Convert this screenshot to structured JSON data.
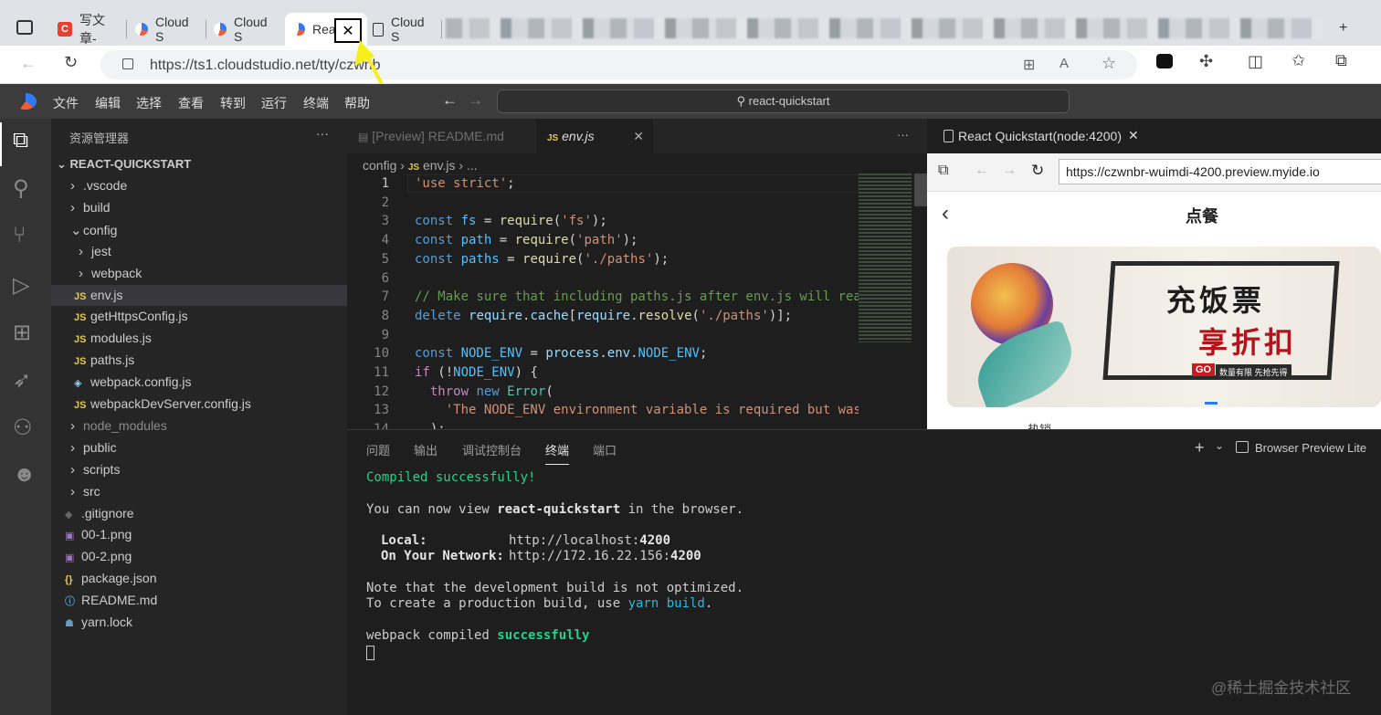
{
  "browser": {
    "tabs": [
      {
        "label": "写文章-",
        "icon": "juejin-icon",
        "color": "#e8402e"
      },
      {
        "label": "Cloud S",
        "icon": "cloudstudio-icon"
      },
      {
        "label": "Cloud S",
        "icon": "cloudstudio-icon"
      },
      {
        "label": "Rea",
        "icon": "cloudstudio-icon",
        "active": true
      },
      {
        "label": "Cloud S",
        "icon": "page-icon"
      }
    ],
    "close_glyph": "✕",
    "url": "https://ts1.cloudstudio.net/tty/czwnb"
  },
  "ide": {
    "menu": [
      "文件",
      "编辑",
      "选择",
      "查看",
      "转到",
      "运行",
      "终端",
      "帮助"
    ],
    "command_center": "react-quickstart",
    "sidebar_title": "资源管理器",
    "sidebar_more": "···",
    "root": "REACT-QUICKSTART",
    "tree": [
      {
        "label": ".vscode",
        "type": "folder"
      },
      {
        "label": "build",
        "type": "folder"
      },
      {
        "label": "config",
        "type": "folder-open"
      },
      {
        "label": "jest",
        "type": "folder",
        "indent": 1
      },
      {
        "label": "webpack",
        "type": "folder",
        "indent": 1
      },
      {
        "label": "env.js",
        "type": "js",
        "indent": 1,
        "selected": true
      },
      {
        "label": "getHttpsConfig.js",
        "type": "js",
        "indent": 1
      },
      {
        "label": "modules.js",
        "type": "js",
        "indent": 1
      },
      {
        "label": "paths.js",
        "type": "js",
        "indent": 1
      },
      {
        "label": "webpack.config.js",
        "type": "webpack",
        "indent": 1
      },
      {
        "label": "webpackDevServer.config.js",
        "type": "js",
        "indent": 1
      },
      {
        "label": "node_modules",
        "type": "folder"
      },
      {
        "label": "public",
        "type": "folder"
      },
      {
        "label": "scripts",
        "type": "folder"
      },
      {
        "label": "src",
        "type": "folder"
      },
      {
        "label": ".gitignore",
        "type": "git",
        "file": true
      },
      {
        "label": "00-1.png",
        "type": "image",
        "file": true
      },
      {
        "label": "00-2.png",
        "type": "image",
        "file": true
      },
      {
        "label": "package.json",
        "type": "json",
        "file": true
      },
      {
        "label": "README.md",
        "type": "info",
        "file": true
      },
      {
        "label": "yarn.lock",
        "type": "yarn",
        "file": true
      }
    ],
    "editor_tabs": [
      {
        "label": "[Preview] README.md"
      },
      {
        "label": "env.js",
        "active": true
      }
    ],
    "breadcrumb": [
      "config",
      "env.js",
      "..."
    ],
    "line_numbers": [
      "1",
      "2",
      "3",
      "4",
      "5",
      "6",
      "7",
      "8",
      "9",
      "10",
      "11",
      "12",
      "13",
      "14"
    ],
    "code": [
      [
        {
          "t": "'use strict'",
          "c": "str"
        },
        {
          "t": ";",
          "c": "pl"
        }
      ],
      [],
      [
        {
          "t": "const ",
          "c": "kw"
        },
        {
          "t": "fs",
          "c": "con"
        },
        {
          "t": " = ",
          "c": "pl"
        },
        {
          "t": "require",
          "c": "fn"
        },
        {
          "t": "(",
          "c": "pl"
        },
        {
          "t": "'fs'",
          "c": "str"
        },
        {
          "t": ");",
          "c": "pl"
        }
      ],
      [
        {
          "t": "const ",
          "c": "kw"
        },
        {
          "t": "path",
          "c": "con"
        },
        {
          "t": " = ",
          "c": "pl"
        },
        {
          "t": "require",
          "c": "fn"
        },
        {
          "t": "(",
          "c": "pl"
        },
        {
          "t": "'path'",
          "c": "str"
        },
        {
          "t": ");",
          "c": "pl"
        }
      ],
      [
        {
          "t": "const ",
          "c": "kw"
        },
        {
          "t": "paths",
          "c": "con"
        },
        {
          "t": " = ",
          "c": "pl"
        },
        {
          "t": "require",
          "c": "fn"
        },
        {
          "t": "(",
          "c": "pl"
        },
        {
          "t": "'./paths'",
          "c": "str"
        },
        {
          "t": ");",
          "c": "pl"
        }
      ],
      [],
      [
        {
          "t": "// Make sure that including paths.js after env.js will rea",
          "c": "cm"
        }
      ],
      [
        {
          "t": "delete ",
          "c": "kw"
        },
        {
          "t": "require",
          "c": "var"
        },
        {
          "t": ".",
          "c": "pl"
        },
        {
          "t": "cache",
          "c": "var"
        },
        {
          "t": "[",
          "c": "pl"
        },
        {
          "t": "require",
          "c": "var"
        },
        {
          "t": ".",
          "c": "pl"
        },
        {
          "t": "resolve",
          "c": "fn"
        },
        {
          "t": "(",
          "c": "pl"
        },
        {
          "t": "'./paths'",
          "c": "str"
        },
        {
          "t": ")];",
          "c": "pl"
        }
      ],
      [],
      [
        {
          "t": "const ",
          "c": "kw"
        },
        {
          "t": "NODE_ENV",
          "c": "con"
        },
        {
          "t": " = ",
          "c": "pl"
        },
        {
          "t": "process",
          "c": "var"
        },
        {
          "t": ".",
          "c": "pl"
        },
        {
          "t": "env",
          "c": "var"
        },
        {
          "t": ".",
          "c": "pl"
        },
        {
          "t": "NODE_ENV",
          "c": "con"
        },
        {
          "t": ";",
          "c": "pl"
        }
      ],
      [
        {
          "t": "if ",
          "c": "kw2"
        },
        {
          "t": "(!",
          "c": "pl"
        },
        {
          "t": "NODE_ENV",
          "c": "con"
        },
        {
          "t": ") {",
          "c": "pl"
        }
      ],
      [
        {
          "t": "  throw ",
          "c": "kw2"
        },
        {
          "t": "new ",
          "c": "kw"
        },
        {
          "t": "Error",
          "c": "cls"
        },
        {
          "t": "(",
          "c": "pl"
        }
      ],
      [
        {
          "t": "    'The NODE_ENV environment variable is required but was",
          "c": "str"
        }
      ],
      [
        {
          "t": "  );",
          "c": "pl"
        }
      ]
    ],
    "preview": {
      "tab_label": "React Quickstart(node:4200)",
      "url": "https://czwnbr-wuimdi-4200.preview.myide.io",
      "page_title": "点餐",
      "banner_line1": "充饭票",
      "banner_line2": "享折扣",
      "banner_go": "GO",
      "banner_small": "数量有限 先抢先得",
      "below": "热销"
    },
    "panel_tabs": [
      "问题",
      "输出",
      "调试控制台",
      "终端",
      "端口"
    ],
    "panel_active": "终端",
    "panel_right": "Browser Preview Lite",
    "terminal": {
      "compiled": "Compiled successfully!",
      "view_prefix": "You can now view ",
      "app_name": "react-quickstart",
      "view_suffix": " in the browser.",
      "local_label": "Local:",
      "local_url": "http://localhost:",
      "local_port": "4200",
      "network_label": "On Your Network:",
      "network_url": "http://172.16.22.156:",
      "network_port": "4200",
      "note1": "Note that the development build is not optimized.",
      "note2_prefix": "To create a production build, use ",
      "note2_cmd": "yarn build",
      "note2_suffix": ".",
      "webpack_prefix": "webpack compiled ",
      "webpack_status": "successfully"
    },
    "watermark": "@稀土掘金技术社区"
  }
}
